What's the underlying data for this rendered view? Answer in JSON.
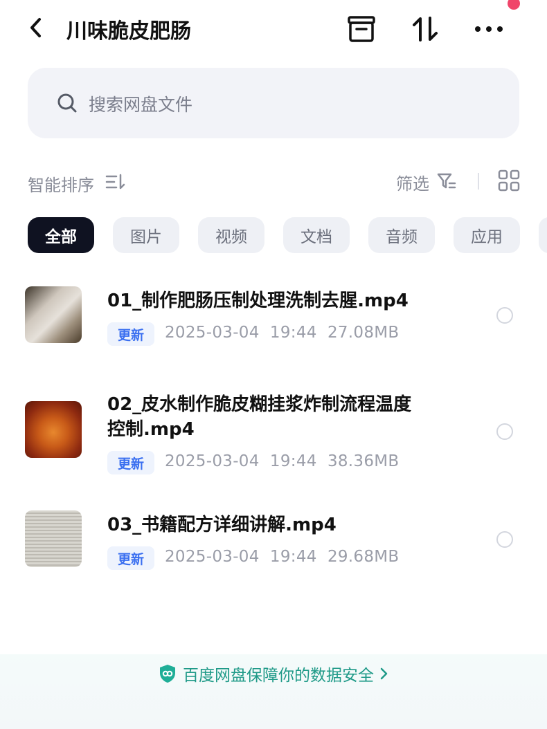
{
  "header": {
    "title": "川味脆皮肥肠",
    "icons": [
      "back-chevron-icon",
      "archive-box-icon",
      "sort-swap-icon",
      "more-dots-icon"
    ]
  },
  "search": {
    "placeholder": "搜索网盘文件"
  },
  "toolbar": {
    "sort_label": "智能排序",
    "filter_label": "筛选"
  },
  "chips": [
    {
      "label": "全部",
      "active": true
    },
    {
      "label": "图片",
      "active": false
    },
    {
      "label": "视频",
      "active": false
    },
    {
      "label": "文档",
      "active": false
    },
    {
      "label": "音频",
      "active": false
    },
    {
      "label": "应用",
      "active": false
    }
  ],
  "files": [
    {
      "name_line1": "01_制作肥肠压制处理洗制去腥.mp4",
      "name_line2": "",
      "badge": "更新",
      "date": "2025-03-04",
      "time": "19:44",
      "size": "27.08MB"
    },
    {
      "name_line1": "02_皮水制作脆皮糊挂浆炸制流程温度",
      "name_line2": "控制.mp4",
      "badge": "更新",
      "date": "2025-03-04",
      "time": "19:44",
      "size": "38.36MB"
    },
    {
      "name_line1": "03_书籍配方详细讲解.mp4",
      "name_line2": "",
      "badge": "更新",
      "date": "2025-03-04",
      "time": "19:44",
      "size": "29.68MB"
    }
  ],
  "footer": {
    "text": "百度网盘保障你的数据安全"
  },
  "colors": {
    "accent_blue": "#3a6ff0",
    "footer_green": "#1f9a88",
    "active_chip": "#0f1221",
    "notification_dot": "#f0456a"
  }
}
